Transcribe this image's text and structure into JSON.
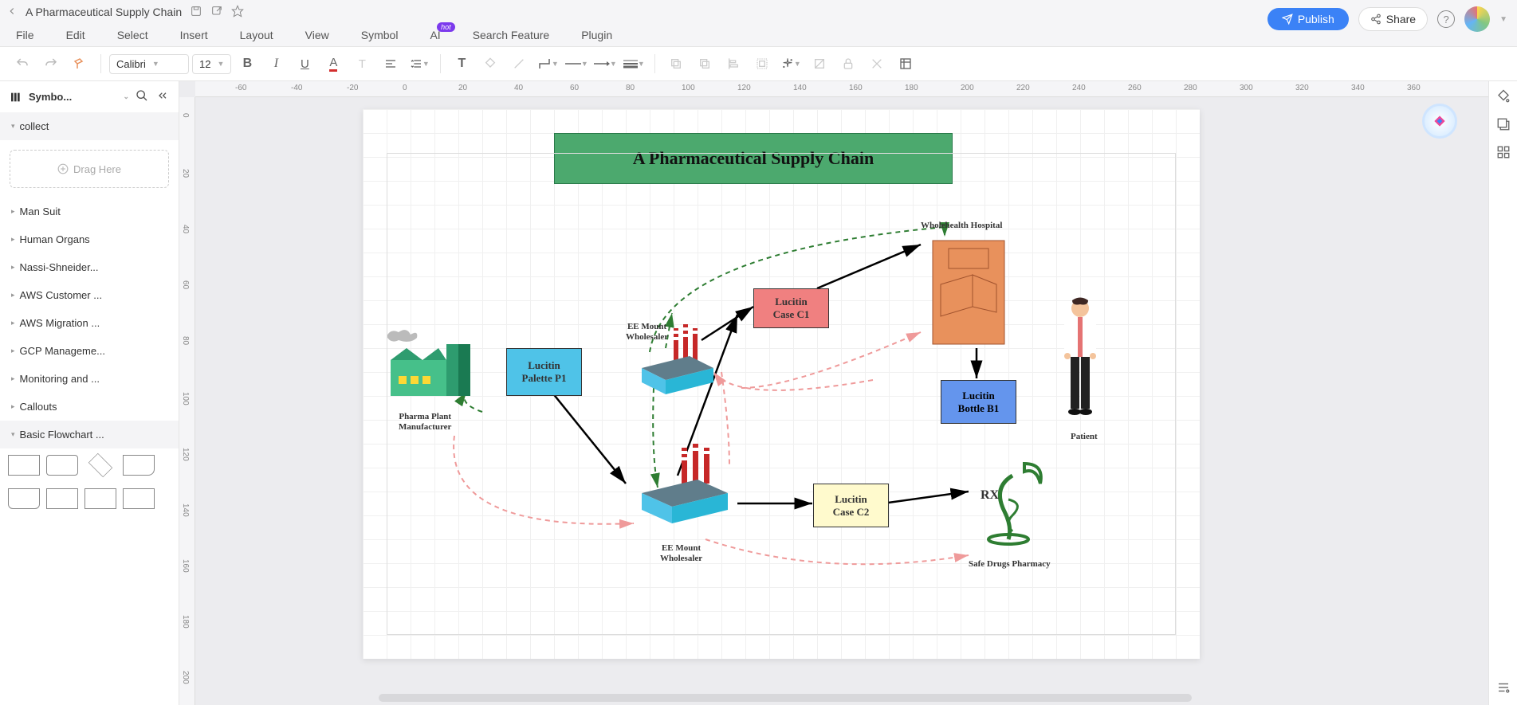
{
  "titlebar": {
    "doc_title": "A Pharmaceutical Supply Chain"
  },
  "top": {
    "publish": "Publish",
    "share": "Share",
    "help": "?"
  },
  "menu": {
    "file": "File",
    "edit": "Edit",
    "select": "Select",
    "insert": "Insert",
    "layout": "Layout",
    "view": "View",
    "symbol": "Symbol",
    "ai": "AI",
    "ai_badge": "hot",
    "search": "Search Feature",
    "plugin": "Plugin"
  },
  "toolbar": {
    "font": "Calibri",
    "size": "12"
  },
  "left": {
    "panel_title": "Symbo...",
    "collect": "collect",
    "drag": "Drag Here",
    "cats": [
      "Man Suit",
      "Human Organs",
      "Nassi-Shneider...",
      "AWS Customer ...",
      "AWS Migration ...",
      "GCP Manageme...",
      "Monitoring and ...",
      "Callouts",
      "Basic Flowchart ..."
    ]
  },
  "ruler_h": [
    "-60",
    "-40",
    "-20",
    "0",
    "20",
    "40",
    "60",
    "80",
    "100",
    "120",
    "140",
    "160",
    "180",
    "200",
    "220",
    "240",
    "260",
    "280",
    "300",
    "320",
    "340",
    "360"
  ],
  "ruler_v": [
    "0",
    "20",
    "40",
    "60",
    "80",
    "100",
    "120",
    "140",
    "160",
    "180",
    "200"
  ],
  "diagram": {
    "title": "A Pharmaceutical Supply Chain",
    "palette": "Lucitin\nPalette P1",
    "case_c1": "Lucitin\nCase C1",
    "case_c2": "Lucitin\nCase C2",
    "bottle": "Lucitin\nBottle B1",
    "hospital_label": "Wholehealth Hospital",
    "pharma_label": "Pharma Plant\nManufacturer",
    "wholesaler1": "EE Mount\nWholesaler",
    "wholesaler2": "EE Mount\nWholesaler",
    "patient": "Patient",
    "pharmacy": "Safe Drugs Pharmacy",
    "rx": "RX"
  }
}
